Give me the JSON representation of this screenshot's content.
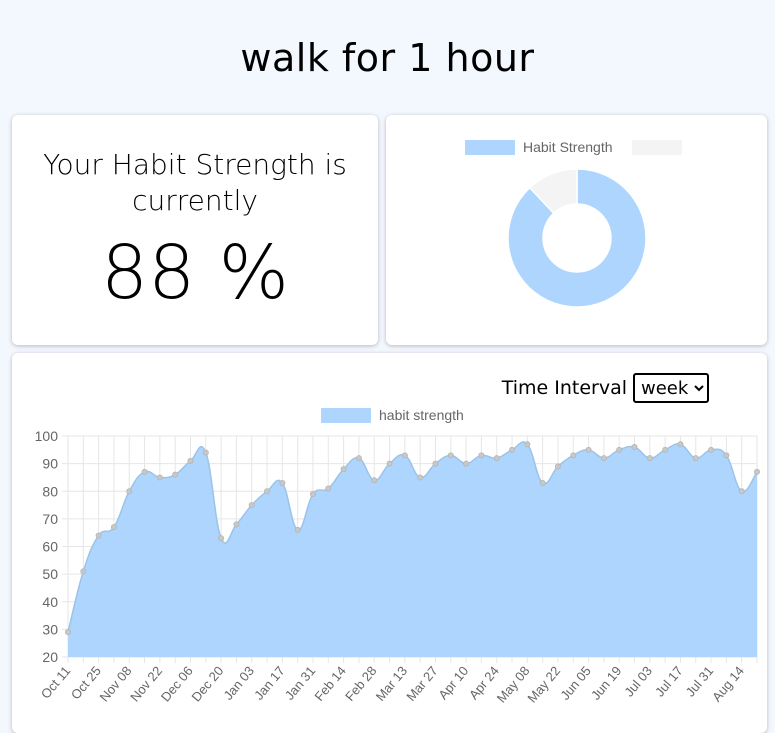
{
  "page": {
    "title": "walk for 1 hour"
  },
  "strength_card": {
    "label": "Your Habit Strength is currently",
    "value": "88 %"
  },
  "donut": {
    "legend": [
      "Habit Strength",
      ""
    ],
    "colors": [
      "#add5fd",
      "#f4f4f4"
    ],
    "values": [
      88,
      12
    ]
  },
  "interval": {
    "label": "Time Interval",
    "selected": "week",
    "options": [
      "week"
    ]
  },
  "colors": {
    "fill": "#add5fd",
    "line": "#9cc3e8",
    "point": "#c8c8c8",
    "grid": "#e6e6e6",
    "axis_text": "#666666"
  },
  "chart_data": {
    "type": "area",
    "series": [
      {
        "name": "habit strength",
        "values": [
          29,
          51,
          64,
          67,
          80,
          87,
          85,
          86,
          91,
          94,
          63,
          68,
          75,
          80,
          83,
          66,
          79,
          81,
          88,
          92,
          84,
          90,
          93,
          85,
          90,
          93,
          90,
          93,
          92,
          95,
          97,
          83,
          89,
          93,
          95,
          92,
          95,
          96,
          92,
          95,
          97,
          92,
          95,
          93,
          80,
          87
        ]
      }
    ],
    "x": [
      "Oct 11",
      "Oct 18",
      "Oct 25",
      "Nov 01",
      "Nov 08",
      "Nov 15",
      "Nov 22",
      "Nov 29",
      "Dec 06",
      "Dec 13",
      "Dec 20",
      "Dec 27",
      "Jan 03",
      "Jan 10",
      "Jan 17",
      "Jan 24",
      "Jan 31",
      "Feb 07",
      "Feb 14",
      "Feb 21",
      "Feb 28",
      "Mar 06",
      "Mar 13",
      "Mar 20",
      "Mar 27",
      "Apr 03",
      "Apr 10",
      "Apr 17",
      "Apr 24",
      "May 01",
      "May 08",
      "May 15",
      "May 22",
      "May 29",
      "Jun 05",
      "Jun 12",
      "Jun 19",
      "Jun 26",
      "Jul 03",
      "Jul 10",
      "Jul 17",
      "Jul 24",
      "Jul 31",
      "Aug 07",
      "Aug 14",
      "Aug 21"
    ],
    "x_tick_labels": [
      "Oct 11",
      "Oct 25",
      "Nov 08",
      "Nov 22",
      "Dec 06",
      "Dec 20",
      "Jan 03",
      "Jan 17",
      "Jan 31",
      "Feb 14",
      "Feb 28",
      "Mar 13",
      "Mar 27",
      "Apr 10",
      "Apr 24",
      "May 08",
      "May 22",
      "Jun 05",
      "Jun 19",
      "Jul 03",
      "Jul 17",
      "Jul 31",
      "Aug 14"
    ],
    "y_ticks": [
      100,
      90,
      80,
      70,
      60,
      50,
      40,
      30,
      20
    ],
    "ylim": [
      20,
      100
    ],
    "grid": true,
    "legend_position": "top-center"
  }
}
